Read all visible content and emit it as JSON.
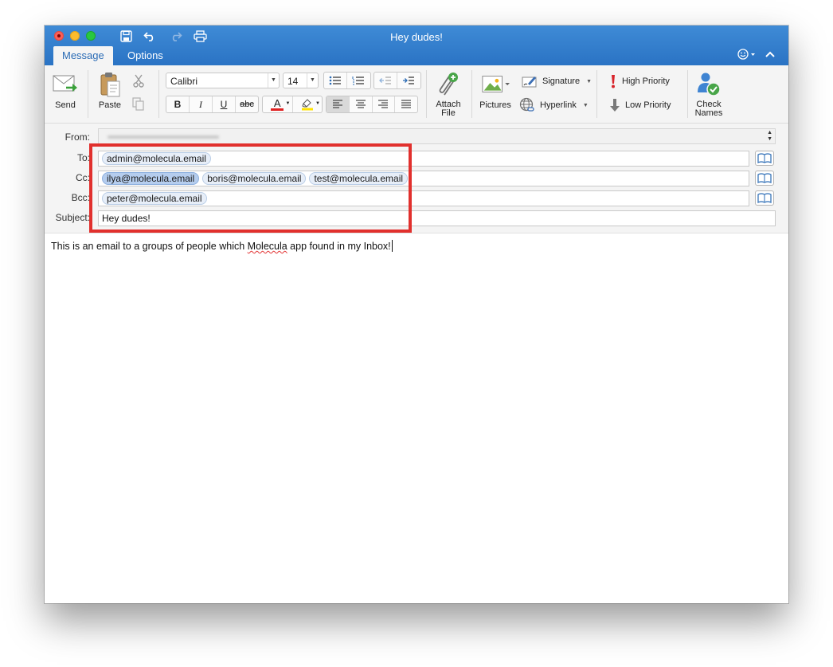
{
  "window": {
    "title": "Hey dudes!"
  },
  "tabs": [
    {
      "label": "Message",
      "active": true
    },
    {
      "label": "Options",
      "active": false
    }
  ],
  "ribbon": {
    "send": "Send",
    "paste": "Paste",
    "font_name": "Calibri",
    "font_size": "14",
    "bold": "B",
    "italic": "I",
    "underline": "U",
    "strikethrough": "abc",
    "font_color_letter": "A",
    "attach_line1": "Attach",
    "attach_line2": "File",
    "pictures": "Pictures",
    "signature": "Signature",
    "hyperlink": "Hyperlink",
    "high_priority": "High Priority",
    "low_priority": "Low Priority",
    "check_line1": "Check",
    "check_line2": "Names"
  },
  "fields": {
    "from_label": "From:",
    "to_label": "To:",
    "cc_label": "Cc:",
    "bcc_label": "Bcc:",
    "subject_label": "Subject:",
    "to": [
      "admin@molecula.email"
    ],
    "cc": [
      "ilya@molecula.email",
      "boris@molecula.email",
      "test@molecula.email"
    ],
    "bcc": [
      "peter@molecula.email"
    ],
    "subject": "Hey dudes!"
  },
  "body": {
    "before": "This is an email to a groups of people which ",
    "misspelled": "Molecula",
    "after": " app found in my Inbox!"
  },
  "colors": {
    "titlebar": "#2a73c4",
    "highlight_box": "#e1302d",
    "chip_selected": "#b5cdee"
  },
  "icons": [
    "save-icon",
    "undo-icon",
    "redo-icon",
    "print-icon",
    "smiley-icon",
    "collapse-chevron-icon",
    "send-icon",
    "paste-icon",
    "cut-icon",
    "copy-icon",
    "bullets-icon",
    "numbering-icon",
    "decrease-indent-icon",
    "increase-indent-icon",
    "highlight-icon",
    "attach-icon",
    "pictures-icon",
    "signature-icon",
    "hyperlink-icon",
    "high-priority-icon",
    "low-priority-icon",
    "check-names-icon",
    "address-book-icon"
  ]
}
